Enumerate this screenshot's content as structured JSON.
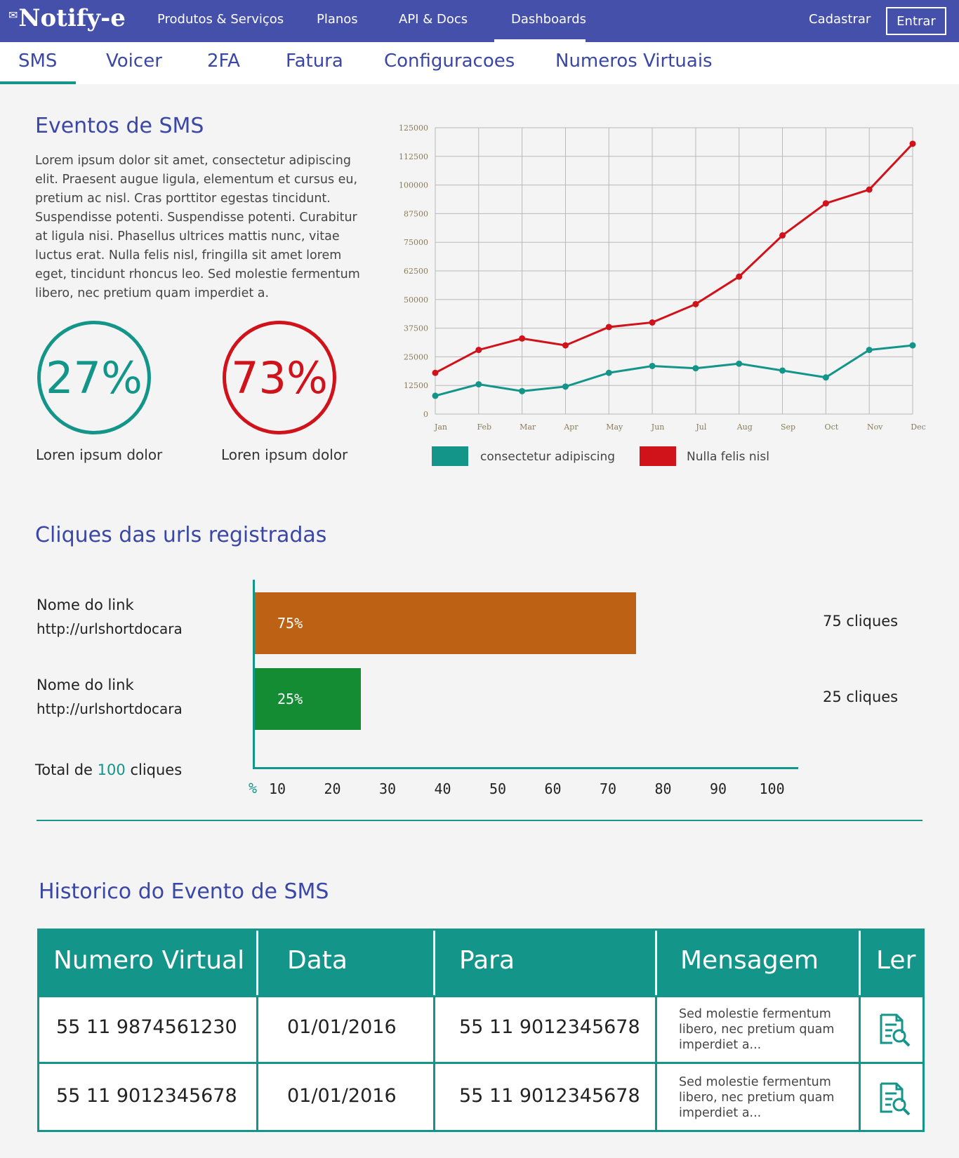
{
  "topbar": {
    "logo": "Notify-e",
    "nav": [
      "Produtos & Serviços",
      "Planos",
      "API & Docs",
      "Dashboards"
    ],
    "active": "Dashboards",
    "signup": "Cadastrar",
    "login": "Entrar"
  },
  "subnav": {
    "tabs": [
      "SMS",
      "Voicer",
      "2FA",
      "Fatura",
      "Configuracoes",
      "Numeros Virtuais"
    ],
    "active": "SMS"
  },
  "eventos": {
    "title": "Eventos de SMS",
    "description": "Lorem ipsum dolor sit amet, consectetur adipiscing elit. Praesent augue ligula, elementum et cursus eu, pretium ac nisl. Cras porttitor egestas tincidunt. Suspendisse potenti. Suspendisse potenti. Curabitur at ligula nisi. Phasellus ultrices mattis nunc, vitae luctus erat. Nulla felis nisl, fringilla sit amet lorem eget, tincidunt rhoncus leo. Sed molestie fermentum libero, nec pretium quam imperdiet a.",
    "stats": [
      {
        "value": "27%",
        "label": "Loren ipsum dolor",
        "color": "#14958a"
      },
      {
        "value": "73%",
        "label": "Loren ipsum dolor",
        "color": "#d0121a"
      }
    ]
  },
  "chart_data": [
    {
      "type": "line",
      "x": [
        "Jan",
        "Feb",
        "Mar",
        "Apr",
        "May",
        "Jun",
        "Jul",
        "Aug",
        "Sep",
        "Oct",
        "Nov",
        "Dec"
      ],
      "yticks": [
        0,
        12500,
        25000,
        37500,
        50000,
        62500,
        75000,
        87500,
        100000,
        112500,
        125000
      ],
      "ylim": [
        0,
        125000
      ],
      "grid": true,
      "legend": "bottom",
      "series": [
        {
          "name": "consectetur adipiscing",
          "color": "#14958a",
          "values": [
            8000,
            13000,
            10000,
            12000,
            18000,
            21000,
            20000,
            22000,
            19000,
            16000,
            28000,
            30000
          ]
        },
        {
          "name": "Nulla felis nisl",
          "color": "#d0121a",
          "values": [
            18000,
            28000,
            33000,
            30000,
            38000,
            40000,
            48000,
            60000,
            78000,
            92000,
            98000,
            118000
          ]
        }
      ]
    },
    {
      "type": "bar",
      "orientation": "horizontal",
      "categories": [
        "Nome do link http://urlshortdocara",
        "Nome do link http://urlshortdocara"
      ],
      "values": [
        75,
        25
      ],
      "xlim": [
        0,
        100
      ],
      "xticks": [
        10,
        20,
        30,
        40,
        50,
        60,
        70,
        80,
        90,
        100
      ],
      "xlabel": "%"
    }
  ],
  "cliques": {
    "title": "Cliques das urls registradas",
    "links": [
      {
        "name": "Nome do link",
        "url": "http://urlshortdocara",
        "percent_label": "75%",
        "percent": 75,
        "clicks_label": "75 cliques",
        "color": "#bd6214"
      },
      {
        "name": "Nome do link",
        "url": "http://urlshortdocara",
        "percent_label": "25%",
        "percent": 25,
        "clicks_label": "25 cliques",
        "color": "#148c33"
      }
    ],
    "total_prefix": "Total de",
    "total_value": "100",
    "total_suffix": "cliques",
    "axis_unit": "%",
    "axis_ticks": [
      "10",
      "20",
      "30",
      "40",
      "50",
      "60",
      "70",
      "80",
      "90",
      "100"
    ]
  },
  "historico": {
    "title": "Historico do Evento de SMS",
    "columns": [
      "Numero Virtual",
      "Data",
      "Para",
      "Mensagem",
      "Ler"
    ],
    "rows": [
      {
        "numero": "55 11 9874561230",
        "data": "01/01/2016",
        "para": "55 11 9012345678",
        "mensagem": "Sed molestie fermentum libero, nec pretium quam imperdiet a...",
        "icon": "read-document-icon"
      },
      {
        "numero": "55 11 9012345678",
        "data": "01/01/2016",
        "para": "55 11 9012345678",
        "mensagem": "Sed molestie fermentum libero, nec pretium quam imperdiet a...",
        "icon": "read-document-icon"
      }
    ]
  }
}
